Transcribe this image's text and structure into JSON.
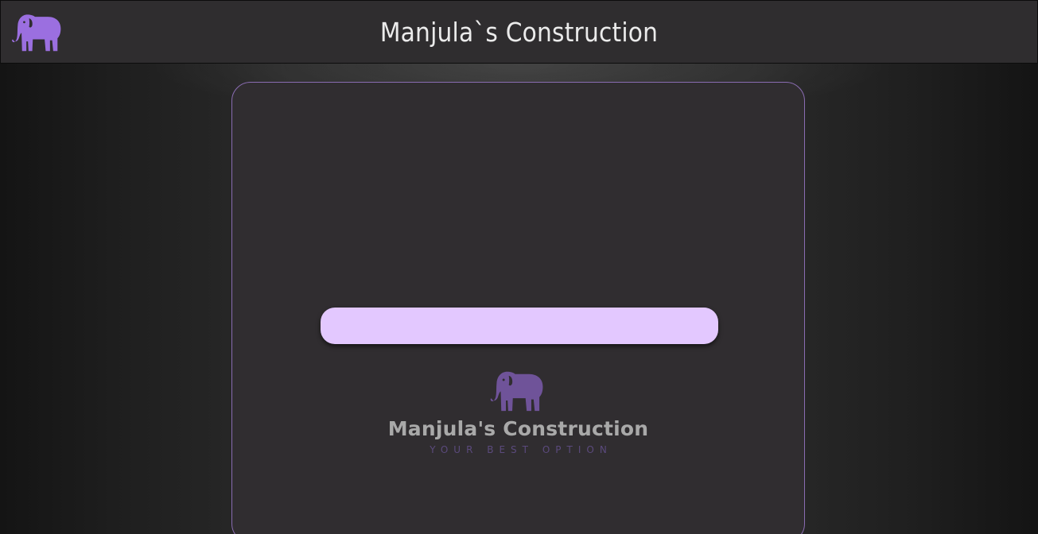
{
  "header": {
    "title": "Manjula`s Construction",
    "logo_icon": "elephant-icon"
  },
  "card": {
    "button_label": "",
    "brand": {
      "icon": "elephant-icon",
      "name": "Manjula's Construction",
      "tagline": "YOUR BEST OPTION"
    }
  },
  "colors": {
    "accent": "#9b6fe0",
    "button": "#e3c8ff",
    "card_border": "#8a6cb2",
    "brand_icon": "#6f5399"
  }
}
